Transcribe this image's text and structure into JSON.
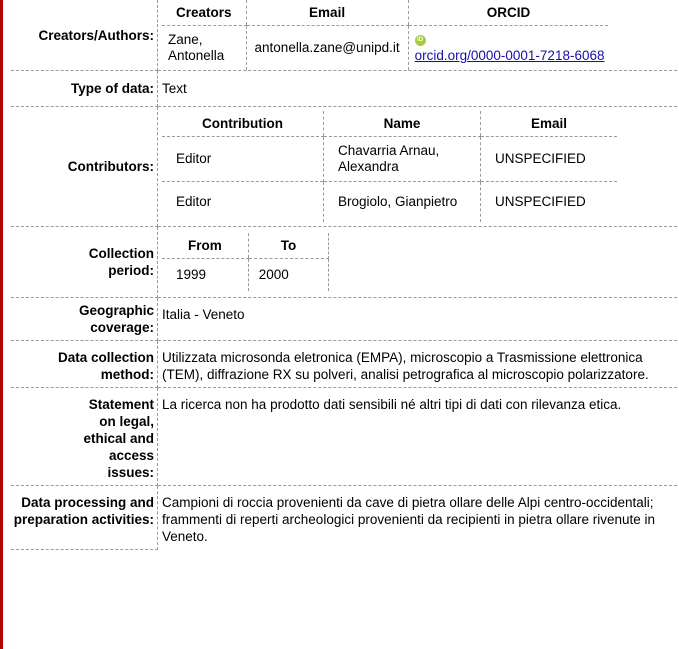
{
  "creators": {
    "row_label": "Creators/Authors:",
    "headers": [
      "Creators",
      "Email",
      "ORCID"
    ],
    "entries": [
      {
        "name": "Zane, Antonella",
        "email": "antonella.zane@unipd.it",
        "orcid_icon": "orcid-icon",
        "orcid_icon_glyph": "iD",
        "orcid": "orcid.org/0000-0001-7218-6068"
      }
    ]
  },
  "type_of_data": {
    "label": "Type of data:",
    "value": "Text"
  },
  "contributors": {
    "row_label": "Contributors:",
    "headers": [
      "Contribution",
      "Name",
      "Email"
    ],
    "entries": [
      {
        "contribution": "Editor",
        "name": "Chavarria Arnau, Alexandra",
        "email": "UNSPECIFIED"
      },
      {
        "contribution": "Editor",
        "name": "Brogiolo, Gianpietro",
        "email": "UNSPECIFIED"
      }
    ]
  },
  "collection_period": {
    "row_label": "Collection period:",
    "headers": [
      "From",
      "To"
    ],
    "from": "1999",
    "to": "2000"
  },
  "geographic_coverage": {
    "label": "Geographic coverage:",
    "value": "Italia - Veneto"
  },
  "data_collection_method": {
    "label": "Data collection method:",
    "value": "Utilizzata microsonda eletronica (EMPA), microscopio a Trasmissione elettronica (TEM), diffrazione RX su polveri, analisi petrografica al microscopio polarizzatore."
  },
  "legal_statement": {
    "label": "Statement on legal, ethical and access issues:",
    "value": "La ricerca non ha prodotto dati sensibili né altri tipi di dati con rilevanza etica."
  },
  "data_processing": {
    "label": "Data processing and preparation activities:",
    "value": "Campioni di roccia provenienti da cave di pietra ollare delle Alpi centro-occidentali; frammenti di reperti archeologici provenienti da recipienti in pietra ollare rivenute in Veneto."
  },
  "colors": {
    "border_accent": "#b00000",
    "link": "#1a0dab",
    "orcid_green": "#a6ce39",
    "dashed_rule": "#9a9a9a"
  }
}
